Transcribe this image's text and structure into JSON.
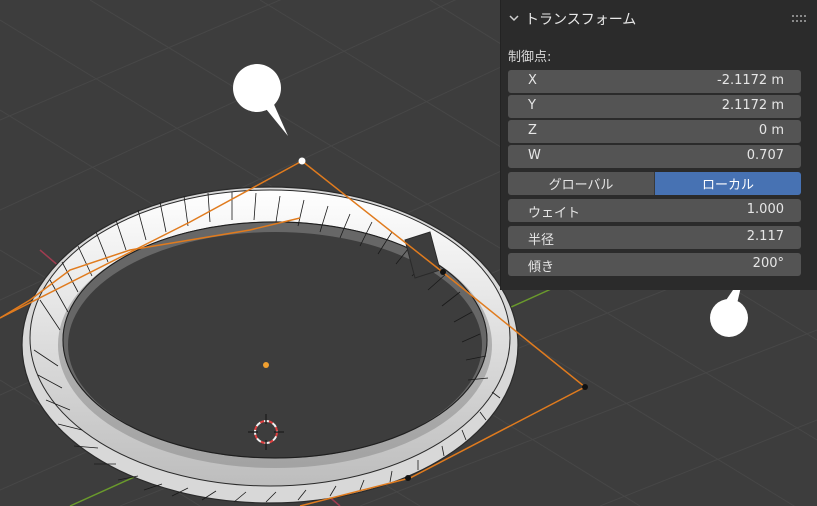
{
  "panel": {
    "title": "トランスフォーム",
    "section_label": "制御点:",
    "fields": [
      {
        "label": "X",
        "value": "-2.1172 m"
      },
      {
        "label": "Y",
        "value": "2.1172 m"
      },
      {
        "label": "Z",
        "value": "0 m"
      },
      {
        "label": "W",
        "value": "0.707"
      }
    ],
    "space_toggle": {
      "options": [
        "グローバル",
        "ローカル"
      ],
      "selected": "ローカル"
    },
    "params": [
      {
        "label": "ウェイト",
        "value": "1.000"
      },
      {
        "label": "半径",
        "value": "2.117"
      },
      {
        "label": "傾き",
        "value": "200°"
      }
    ]
  },
  "colors": {
    "accent": "#4772b3",
    "curve": "#e07b1e",
    "x_axis": "#a03c50",
    "y_axis": "#6a9a2c"
  }
}
